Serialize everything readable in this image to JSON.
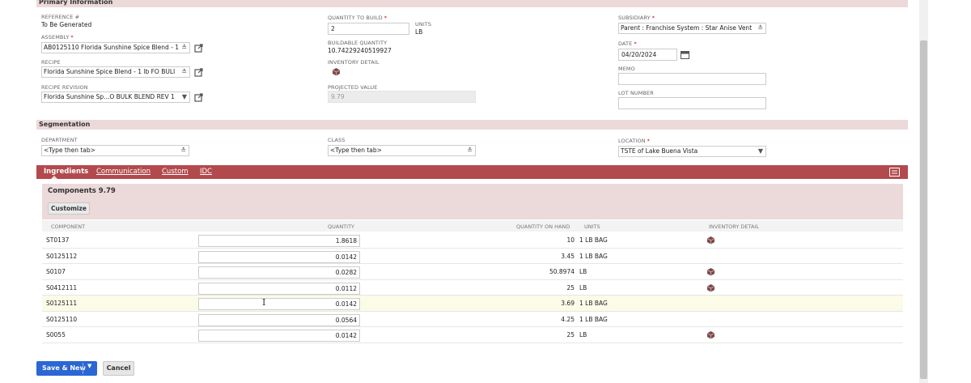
{
  "sections": {
    "primary": "Primary Information",
    "segmentation": "Segmentation"
  },
  "primary": {
    "reference_label": "REFERENCE #",
    "reference_value": "To Be Generated",
    "assembly_label": "ASSEMBLY",
    "assembly_value": "AB0125110 Florida Sunshine Spice Blend - 1",
    "recipe_label": "RECIPE",
    "recipe_value": "Florida Sunshine Spice Blend - 1 lb FO BULI",
    "recipe_revision_label": "RECIPE REVISION",
    "recipe_revision_value": "Florida Sunshine Sp...O BULK BLEND REV 1",
    "quantity_label": "QUANTITY TO BUILD",
    "quantity_value": "2",
    "units_label": "UNITS",
    "units_value": "LB",
    "buildable_label": "BUILDABLE QUANTITY",
    "buildable_value": "10.74229240519927",
    "inventory_detail_label": "INVENTORY DETAIL",
    "projected_label": "PROJECTED VALUE",
    "projected_value": "9.79",
    "subsidiary_label": "SUBSIDIARY",
    "subsidiary_value": "Parent : Franchise System : Star Anise Vent",
    "date_label": "DATE",
    "date_value": "04/20/2024",
    "memo_label": "MEMO",
    "memo_value": "",
    "lot_label": "LOT NUMBER",
    "lot_value": ""
  },
  "segmentation": {
    "department_label": "DEPARTMENT",
    "department_value": "<Type then tab>",
    "class_label": "CLASS",
    "class_value": "<Type then tab>",
    "location_label": "LOCATION",
    "location_value": "TSTE of Lake Buena Vista"
  },
  "tabs": [
    "Ingredients",
    "Communication",
    "Custom",
    "IDC"
  ],
  "components": {
    "title": "Components 9.79",
    "customize_label": "Customize",
    "headers": [
      "COMPONENT",
      "QUANTITY",
      "QUANTITY ON HAND",
      "UNITS",
      "INVENTORY DETAIL"
    ],
    "rows": [
      {
        "component": "ST0137",
        "quantity": "1.8618",
        "on_hand": "10",
        "units": "1 LB BAG",
        "inv": true
      },
      {
        "component": "S0125112",
        "quantity": "0.0142",
        "on_hand": "3.45",
        "units": "1 LB BAG",
        "inv": false
      },
      {
        "component": "S0107",
        "quantity": "0.0282",
        "on_hand": "50.8974",
        "units": "LB",
        "inv": true
      },
      {
        "component": "S0412111",
        "quantity": "0.0112",
        "on_hand": "25",
        "units": "LB",
        "inv": true
      },
      {
        "component": "S0125111",
        "quantity": "0.0142",
        "on_hand": "3.69",
        "units": "1 LB BAG",
        "inv": false
      },
      {
        "component": "S0125110",
        "quantity": "0.0564",
        "on_hand": "4.25",
        "units": "1 LB BAG",
        "inv": false
      },
      {
        "component": "S0055",
        "quantity": "0.0142",
        "on_hand": "25",
        "units": "LB",
        "inv": true
      }
    ]
  },
  "buttons": {
    "save_new": "Save & New",
    "cancel": "Cancel"
  },
  "colors": {
    "tab_bar": "#b24a4d",
    "section_bg": "#ecd9da",
    "primary_button": "#2b66d4"
  }
}
